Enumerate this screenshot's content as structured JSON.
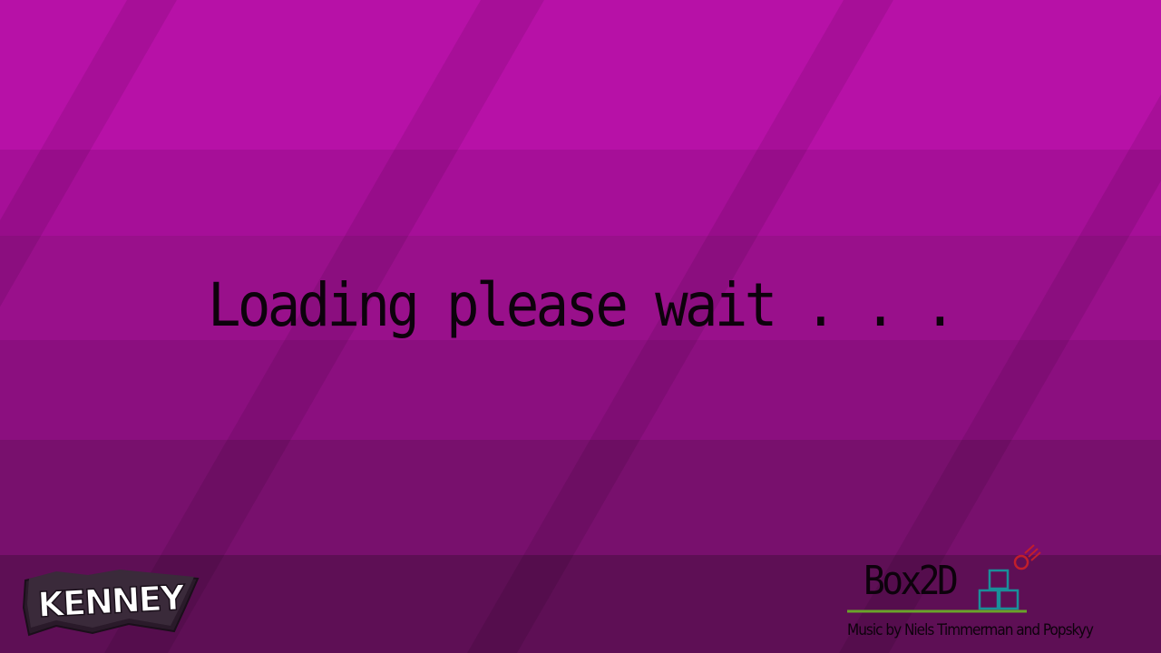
{
  "screen": {
    "colors": {
      "band_1": "#b711a7",
      "band_2": "#a60f98",
      "band_3": "#99108b",
      "band_4": "#8b0f7f",
      "band_5": "#78106d",
      "band_6": "#5e0f55",
      "text": "#0d020c"
    }
  },
  "loading": {
    "message": "Loading please wait . . ."
  },
  "branding": {
    "kenney_logo": {
      "text": "KENNEY",
      "icon": "kenney-logo"
    },
    "box2d_logo": {
      "text": "Box2D",
      "icon": "box2d-logo",
      "colors": {
        "boxes": "#1a8f9a",
        "ground": "#6aa32a",
        "ball": "#c21e2b"
      }
    },
    "music_credit": "Music by Niels Timmerman and Popskyy"
  }
}
